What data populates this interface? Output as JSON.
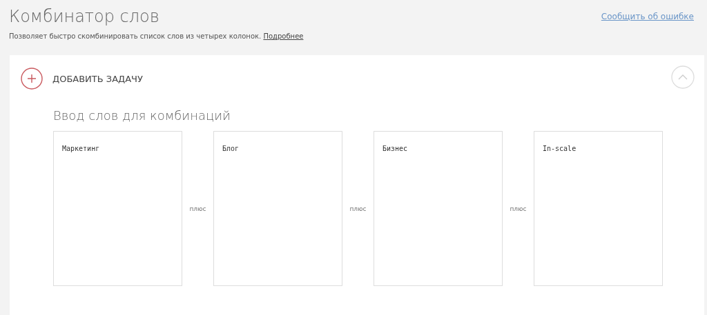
{
  "header": {
    "title": "Комбинатор слов",
    "description": "Позволяет быстро скомбинировать список слов из четырех колонок.",
    "more_link": "Подробнее",
    "report_link": "Сообщить об ошибке"
  },
  "card": {
    "add_task": "ДОБАВИТЬ ЗАДАЧУ",
    "expanded": true,
    "section_title": "Ввод слов для комбинаций",
    "columns": [
      {
        "value": "Маркетинг"
      },
      {
        "value": "Блог"
      },
      {
        "value": "Бизнес"
      },
      {
        "value": "In-scale"
      }
    ],
    "separators": [
      "плюс",
      "плюс",
      "плюс"
    ]
  }
}
